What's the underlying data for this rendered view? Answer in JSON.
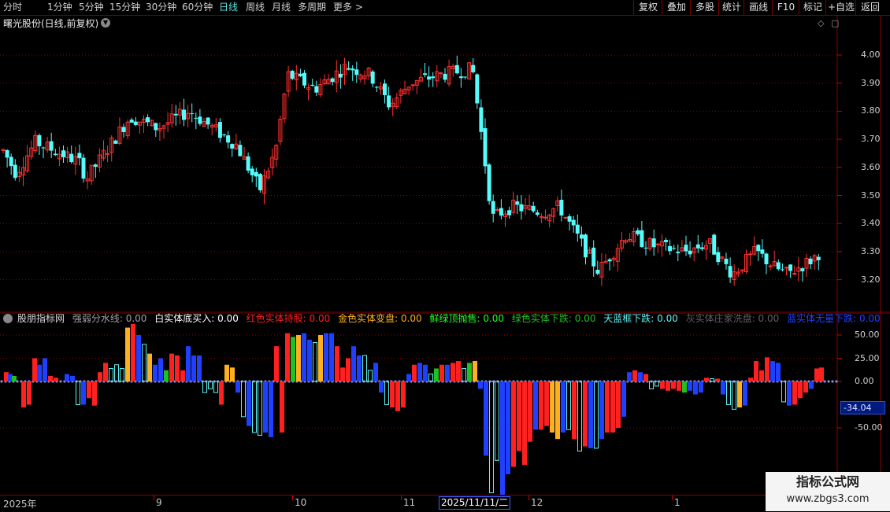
{
  "toolbar": {
    "periods": [
      "分时",
      "1分钟",
      "5分钟",
      "15分钟",
      "30分钟",
      "60分钟",
      "日线",
      "周线",
      "月线",
      "多周期",
      "更多 >"
    ],
    "active_period": "日线",
    "right_buttons": [
      "复权",
      "叠加",
      "多股",
      "统计",
      "画线",
      "F10",
      "标记",
      "+自选",
      "返回"
    ]
  },
  "main": {
    "title": "曙光股份(日线,前复权)",
    "y_ticks": [
      "4.00",
      "3.90",
      "3.80",
      "3.70",
      "3.60",
      "3.50",
      "3.40",
      "3.30",
      "3.20"
    ]
  },
  "indicator": {
    "name": "股朋指标网",
    "legend": [
      {
        "label": "强弱分水线: 0.00",
        "color": "#a0a0a0"
      },
      {
        "label": "白实体底买入: 0.00",
        "color": "#ffffff"
      },
      {
        "label": "红色实体持股: 0.00",
        "color": "#ff2020"
      },
      {
        "label": "金色实体变盘: 0.00",
        "color": "#ffb020"
      },
      {
        "label": "鲜绿顶抛售: 0.00",
        "color": "#20ff20"
      },
      {
        "label": "绿色实体下跌: 0.00",
        "color": "#20c020"
      },
      {
        "label": "天蓝框下跌: 0.00",
        "color": "#60f0f0"
      },
      {
        "label": "灰实体庄家洗盘: 0.00",
        "color": "#606060"
      },
      {
        "label": "蓝实体无量下跌: 0.00",
        "color": "#2040ff"
      }
    ],
    "y_ticks": [
      "50.00",
      "25.00",
      "0.00",
      "-50.00"
    ],
    "current_value": "-34.04"
  },
  "date_axis": {
    "labels": [
      "2025年",
      "9",
      "10",
      "11",
      "2025/11/11/二",
      "12",
      "1"
    ]
  },
  "watermark": {
    "line1": "指标公式网",
    "line2": "www.zbgs3.com"
  },
  "colors": {
    "up": "#ff3030",
    "down": "#54fcfc",
    "grid": "#8a0000"
  }
}
